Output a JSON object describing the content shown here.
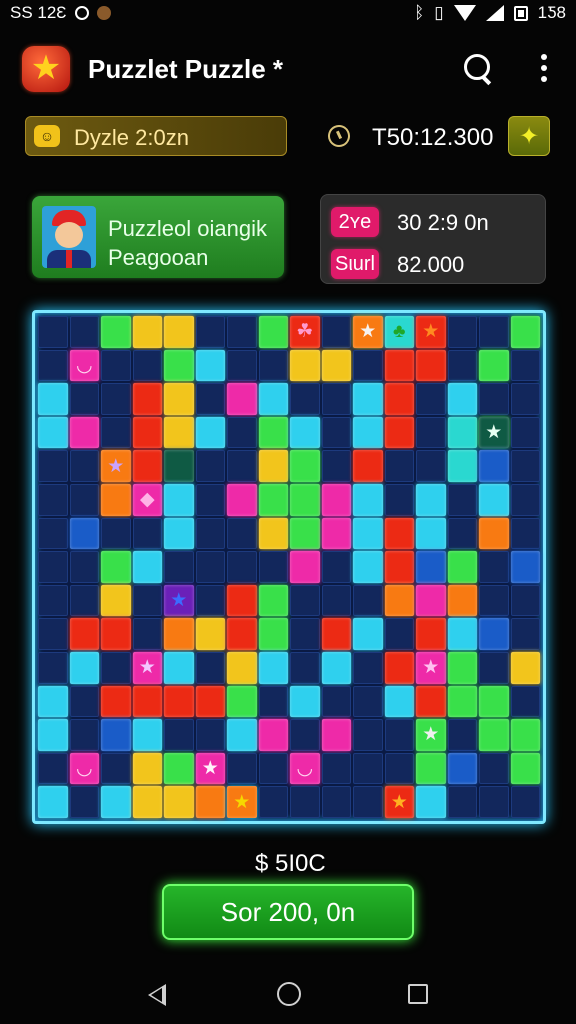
{
  "status_bar": {
    "left_text": "ЅЅ 12Ɛ",
    "right_text": "1Ƽ8",
    "icons": [
      "circle-icon",
      "cookie-icon",
      "bluetooth-icon",
      "vibrate-icon",
      "wifi-icon",
      "signal-icon",
      "battery-icon"
    ]
  },
  "app_bar": {
    "title": "Puzzlet Puzzle *",
    "logo_glyph": "★"
  },
  "header": {
    "puzzle_label": "Dyzle 2:0zn",
    "puzzle_chip": "☺",
    "timer": "T50:12.300",
    "leaf_glyph": "✦"
  },
  "player": {
    "name": "Puzzleol oiangik",
    "subtitle": "Peagooan"
  },
  "stats": [
    {
      "label": "2ʏe",
      "value": "30 2:9 0n"
    },
    {
      "label": "Sιurl",
      "value": "82.000"
    }
  ],
  "board": {
    "palette": {
      "N": "#12275c",
      "B": "#2fd0ee",
      "G": "#39e04a",
      "Y": "#f2c51c",
      "R": "#ec2a14",
      "P": "#ee2aa8",
      "O": "#f87a12",
      "C": "#2ad8d0",
      "D": "#1a5cc8",
      "V": "#6b20b8",
      "T": "#0f5a44"
    },
    "rows": [
      "NNGYYNNGRNYBRNNG",
      "NPNNGBNNYYNRRNGN",
      "BNNRYNPBNNBRNBNN",
      "BPNRYBNGBNBRNCGN",
      "NNORTNNYGNRNNCDN",
      "NNOPBNPGGPBNBNBN",
      "NDNNBNNYGPBRBNON",
      "NNGBNNNNPNBRDGND",
      "NNYNVNRGNNNOPONN",
      "NRRNOYRGNRBNRBDN",
      "NBNPBNYBNBNRPGNY",
      "BNRRRRGNBNNBRGGN",
      "BNDBNNBPNPNNGNGG",
      "NPNYGPNNPNNNGDNG",
      "BNBYYOBNNNNOBNNN"
    ],
    "items": [
      {
        "row": 0,
        "col": 8,
        "glyph": "☘",
        "color": "R",
        "fg": "#ff9ad0"
      },
      {
        "row": 0,
        "col": 10,
        "glyph": "★",
        "color": "O",
        "fg": "#f6f2f0"
      },
      {
        "row": 0,
        "col": 11,
        "glyph": "♣",
        "color": "C",
        "fg": "#1fa72a"
      },
      {
        "row": 0,
        "col": 12,
        "glyph": "★",
        "color": "R",
        "fg": "#ff8a20"
      },
      {
        "row": 1,
        "col": 1,
        "glyph": "◡",
        "color": "P",
        "fg": "#ffd6f0"
      },
      {
        "row": 3,
        "col": 14,
        "glyph": "★",
        "color": "T",
        "fg": "#e6fff2"
      },
      {
        "row": 4,
        "col": 2,
        "glyph": "★",
        "color": "O",
        "fg": "#c9a2ff"
      },
      {
        "row": 5,
        "col": 3,
        "glyph": "◆",
        "color": "P",
        "fg": "#ffb2e6"
      },
      {
        "row": 8,
        "col": 4,
        "glyph": "★",
        "color": "V",
        "fg": "#3c6cff"
      },
      {
        "row": 10,
        "col": 3,
        "glyph": "★",
        "color": "P",
        "fg": "#f3c6ff"
      },
      {
        "row": 10,
        "col": 12,
        "glyph": "★",
        "color": "P",
        "fg": "#ffc0f0"
      },
      {
        "row": 12,
        "col": 12,
        "glyph": "★",
        "color": "G",
        "fg": "#f0f0f0"
      },
      {
        "row": 13,
        "col": 1,
        "glyph": "◡",
        "color": "P",
        "fg": "#ffd6f0"
      },
      {
        "row": 13,
        "col": 5,
        "glyph": "★",
        "color": "P",
        "fg": "#fff0fa"
      },
      {
        "row": 13,
        "col": 8,
        "glyph": "◡",
        "color": "P",
        "fg": "#ffd6f0"
      },
      {
        "row": 14,
        "col": 6,
        "glyph": "★",
        "color": "O",
        "fg": "#f6d800"
      },
      {
        "row": 14,
        "col": 11,
        "glyph": "★",
        "color": "R",
        "fg": "#ffb020"
      }
    ]
  },
  "score": "$ 5I0C",
  "play_button": "Sor 200, 0n",
  "nav": {
    "back": "back",
    "home": "home",
    "recents": "recents"
  }
}
